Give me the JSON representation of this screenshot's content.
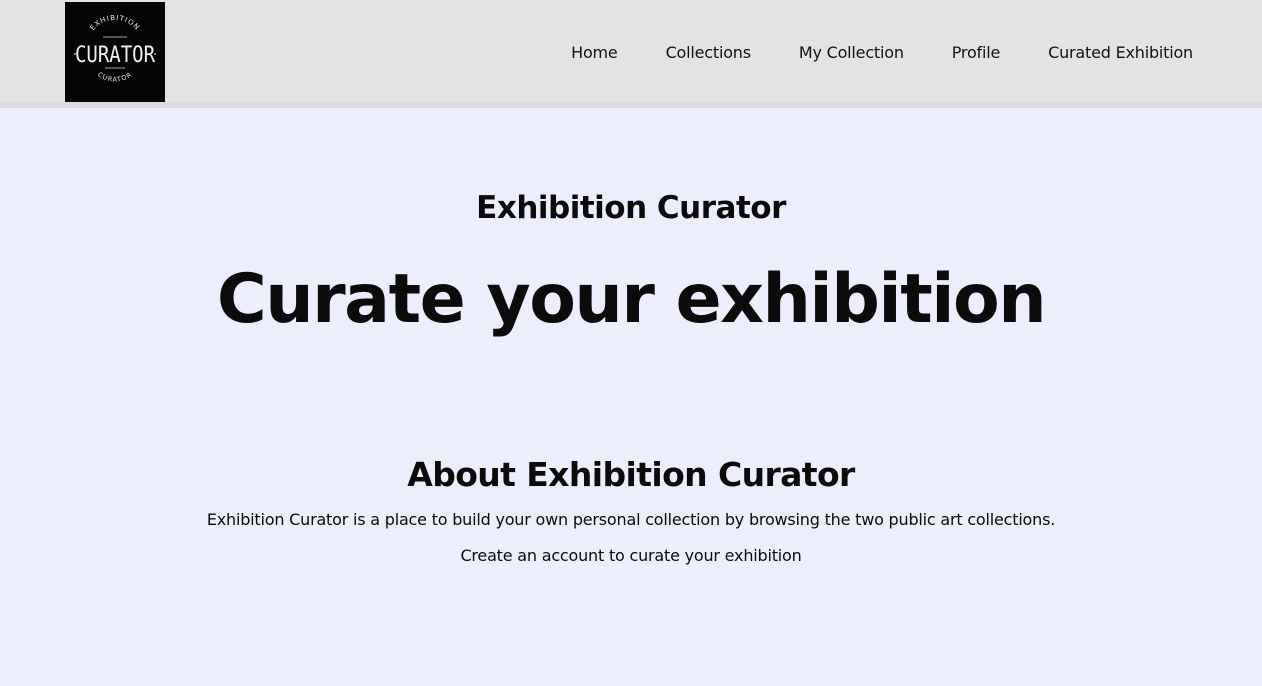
{
  "header": {
    "logo": {
      "top_text": "EXHIBITION",
      "main_text": "CURATOR",
      "bottom_text": "CURATOR"
    },
    "nav": [
      {
        "label": "Home"
      },
      {
        "label": "Collections"
      },
      {
        "label": "My Collection"
      },
      {
        "label": "Profile"
      },
      {
        "label": "Curated Exhibition"
      }
    ]
  },
  "main": {
    "site_title": "Exhibition Curator",
    "hero_heading": "Curate your exhibition",
    "about": {
      "heading": "About Exhibition Curator",
      "paragraph1": "Exhibition Curator is a place to build your own personal collection by browsing the two public art collections.",
      "paragraph2": "Create an account to curate your exhibition"
    }
  },
  "colors": {
    "page_background": "#eceefb",
    "header_background": "#e3e3e6",
    "logo_background": "#050505",
    "text": "#0b0b0b"
  }
}
